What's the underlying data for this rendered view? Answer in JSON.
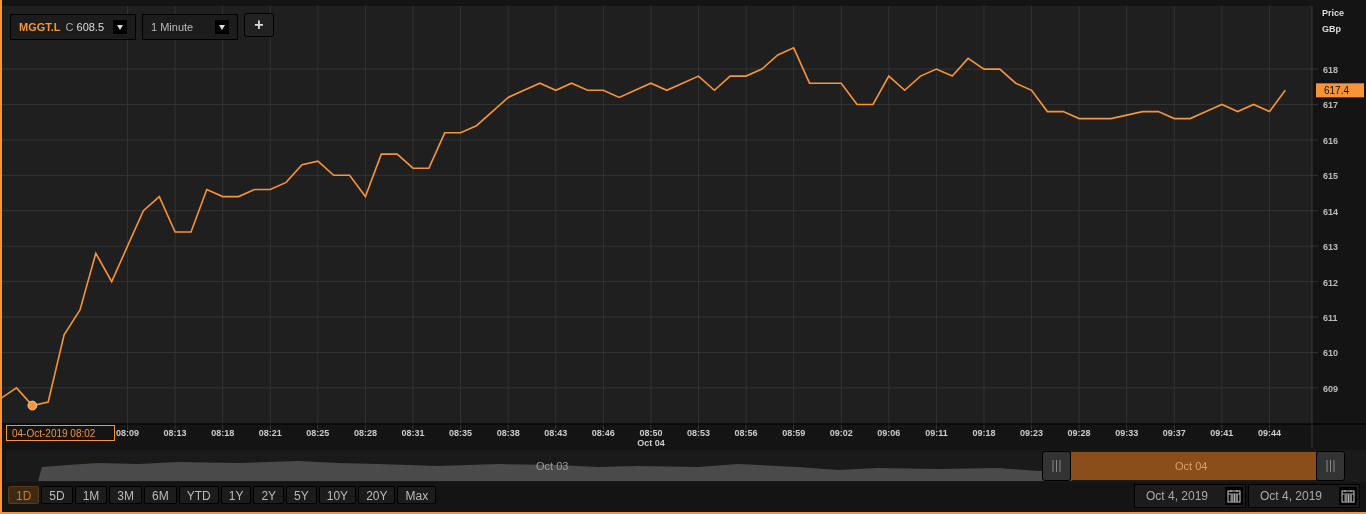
{
  "toolbar": {
    "symbol": "MGGT.L",
    "price_type": "C",
    "price": "608.5",
    "interval": "1 Minute",
    "add_button": "+"
  },
  "chart": {
    "last_price": "617.4",
    "crosshair_label": "04-Oct-2019 08:02",
    "day_label": "Oct 04",
    "chart_data": {
      "type": "line",
      "grid": true,
      "ylabel": "Price GBp",
      "categories": [
        null,
        null,
        null,
        null,
        null,
        null,
        null,
        null,
        "08:09",
        null,
        null,
        "08:13",
        null,
        null,
        "08:18",
        null,
        null,
        "08:21",
        null,
        null,
        "08:25",
        null,
        null,
        "08:28",
        null,
        null,
        "08:31",
        null,
        null,
        "08:35",
        null,
        null,
        "08:38",
        null,
        null,
        "08:43",
        null,
        null,
        "08:46",
        null,
        null,
        "08:50",
        null,
        null,
        "08:53",
        null,
        null,
        "08:56",
        null,
        null,
        "08:59",
        null,
        null,
        "09:02",
        null,
        null,
        "09:06",
        null,
        null,
        "09:11",
        null,
        null,
        "09:18",
        null,
        null,
        "09:23",
        null,
        null,
        "09:28",
        null,
        null,
        "09:33",
        null,
        null,
        "09:37",
        null,
        null,
        "09:41",
        null,
        null,
        "09:44",
        null
      ],
      "ylim": [
        607.98,
        619.78
      ],
      "series": [
        {
          "color": "#f7943a",
          "values": [
            608.7,
            609,
            608.5,
            608.6,
            610.5,
            611.2,
            612.8,
            612,
            613,
            614,
            614.4,
            613.4,
            613.4,
            614.6,
            614.4,
            614.4,
            614.6,
            614.6,
            614.8,
            615.3,
            615.4,
            615,
            615,
            614.4,
            615.6,
            615.6,
            615.2,
            615.2,
            616.2,
            616.2,
            616.4,
            616.8,
            617.2,
            617.4,
            617.6,
            617.4,
            617.6,
            617.4,
            617.4,
            617.2,
            617.4,
            617.6,
            617.4,
            617.6,
            617.8,
            617.4,
            617.8,
            617.8,
            618,
            618.4,
            618.6,
            617.6,
            617.6,
            617.6,
            617,
            617,
            617.8,
            617.4,
            617.8,
            618,
            617.8,
            618.3,
            618,
            618,
            617.6,
            617.4,
            616.8,
            616.8,
            616.6,
            616.6,
            616.6,
            616.7,
            616.8,
            616.8,
            616.6,
            616.6,
            616.8,
            617,
            616.8,
            617,
            616.8,
            617.4
          ]
        }
      ],
      "yticks": [
        609,
        610,
        611,
        612,
        613,
        614,
        615,
        616,
        617,
        618
      ]
    }
  },
  "navigator": {
    "labels": [
      "Oct 03",
      "Oct 04"
    ]
  },
  "ranges": [
    {
      "label": "1D",
      "selected": true
    },
    {
      "label": "5D",
      "selected": false
    },
    {
      "label": "1M",
      "selected": false
    },
    {
      "label": "3M",
      "selected": false
    },
    {
      "label": "6M",
      "selected": false
    },
    {
      "label": "YTD",
      "selected": false
    },
    {
      "label": "1Y",
      "selected": false
    },
    {
      "label": "2Y",
      "selected": false
    },
    {
      "label": "5Y",
      "selected": false
    },
    {
      "label": "10Y",
      "selected": false
    },
    {
      "label": "20Y",
      "selected": false
    },
    {
      "label": "Max",
      "selected": false
    }
  ],
  "date_range": {
    "from": "Oct 4, 2019",
    "to": "Oct 4, 2019"
  }
}
